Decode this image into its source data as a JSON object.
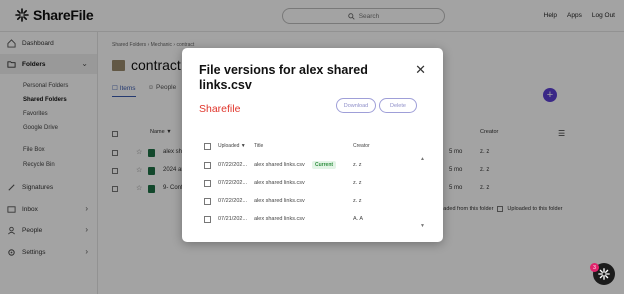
{
  "app": {
    "name": "ShareFile"
  },
  "header": {
    "search_placeholder": "Search",
    "links": [
      "Help",
      "Apps",
      "Log Out"
    ]
  },
  "sidebar": {
    "items": [
      {
        "label": "Dashboard",
        "icon": "home-icon"
      },
      {
        "label": "Folders",
        "icon": "folder-icon"
      },
      {
        "label": "Signatures",
        "icon": "pen-icon"
      },
      {
        "label": "Inbox",
        "icon": "inbox-icon"
      },
      {
        "label": "People",
        "icon": "people-icon"
      },
      {
        "label": "Settings",
        "icon": "gear-icon"
      }
    ],
    "sub_items": [
      "Personal Folders",
      "Shared Folders",
      "Favorites",
      "Google Drive",
      "File Box",
      "Recycle Bin"
    ]
  },
  "main": {
    "breadcrumb": "Shared Folders  ›  Mechanic  ›  contract",
    "folder_title": "contract",
    "tabs": [
      "Items",
      "People"
    ],
    "columns": {
      "name": "Name ▼",
      "creator": "Creator"
    },
    "rows": [
      {
        "name": "alex shared",
        "size": "5 mo",
        "creator": "z. z"
      },
      {
        "name": "2024 amazi",
        "size": "5 mo",
        "creator": "z. z"
      },
      {
        "name": "9- Configure",
        "size": "5 mo",
        "creator": "z. z"
      }
    ],
    "bottom_text_1": "loaded from this folder",
    "bottom_text_2": "Uploaded to this folder"
  },
  "modal": {
    "title": "File versions for alex shared links.csv",
    "brand": "Sharefile",
    "download_label": "Download",
    "delete_label": "Delete",
    "columns": {
      "uploaded": "Uploaded ▼",
      "title": "Title",
      "creator": "Creator"
    },
    "versions": [
      {
        "uploaded": "07/22/202...",
        "title": "alex shared links.csv",
        "badge": "Current",
        "creator": "z. z"
      },
      {
        "uploaded": "07/22/202...",
        "title": "alex shared links.csv",
        "badge": "",
        "creator": "z. z"
      },
      {
        "uploaded": "07/22/202...",
        "title": "alex shared links.csv",
        "badge": "",
        "creator": "z. z"
      },
      {
        "uploaded": "07/21/202...",
        "title": "alex shared links.csv",
        "badge": "",
        "creator": "A. A"
      }
    ]
  },
  "help": {
    "badge_count": "3"
  },
  "colors": {
    "accent": "#5b3fd4",
    "brand_red": "#e0352b",
    "current_green": "#2f8f3f"
  }
}
